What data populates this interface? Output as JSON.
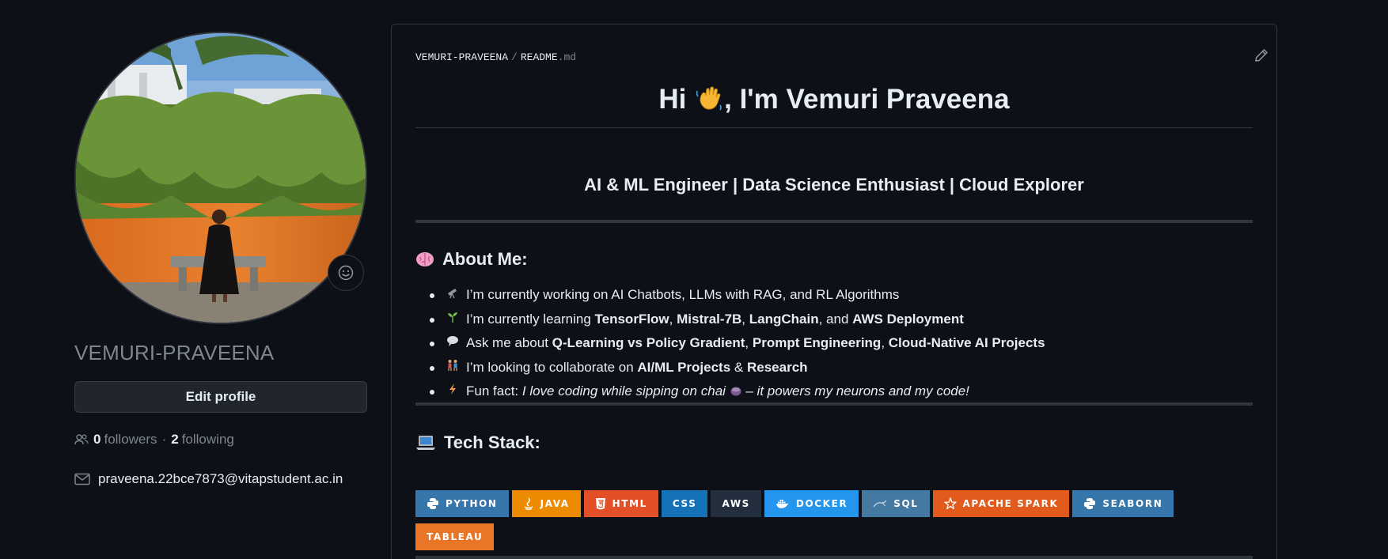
{
  "profile": {
    "username": "VEMURI-PRAVEENA",
    "edit_profile_label": "Edit profile",
    "followers_count": "0",
    "followers_label": "followers",
    "separator": "·",
    "following_count": "2",
    "following_label": "following",
    "email": "praveena.22bce7873@vitapstudent.ac.in"
  },
  "readme": {
    "crumb_owner": "VEMURI-PRAVEENA",
    "crumb_slash": "/",
    "crumb_file": "README",
    "crumb_ext": ".md",
    "title_pre": "Hi ",
    "title_post": ", I'm Vemuri Praveena",
    "subtitle": "AI & ML Engineer | Data Science Enthusiast | Cloud Explorer",
    "about_heading": "About Me:",
    "about": {
      "item1": "I’m currently working on AI Chatbots, LLMs with RAG, and RL Algorithms",
      "item2_pre": "I’m currently learning ",
      "item2_b1": "TensorFlow",
      "item2_s1": ", ",
      "item2_b2": "Mistral-7B",
      "item2_s2": ", ",
      "item2_b3": "LangChain",
      "item2_s3": ", and ",
      "item2_b4": "AWS Deployment",
      "item3_pre": "Ask me about ",
      "item3_b1": "Q-Learning vs Policy Gradient",
      "item3_s1": ", ",
      "item3_b2": "Prompt Engineering",
      "item3_s2": ", ",
      "item3_b3": "Cloud-Native AI Projects",
      "item4_pre": "I’m looking to collaborate on ",
      "item4_b1": "AI/ML Projects",
      "item4_s1": " & ",
      "item4_b2": "Research",
      "item5_pre": "Fun fact: ",
      "item5_i1": "I love coding while sipping on chai ",
      "item5_i2": " – it powers my neurons and my code!"
    },
    "tech_heading": "Tech Stack:",
    "badges": [
      {
        "label": "PYTHON",
        "color": "#3776ab",
        "icon": "python-icon"
      },
      {
        "label": "JAVA",
        "color": "#ed8b00",
        "icon": "java-icon"
      },
      {
        "label": "HTML",
        "color": "#e34f26",
        "icon": "html5-icon"
      },
      {
        "label": "CSS",
        "color": "#1572b6",
        "icon": ""
      },
      {
        "label": "AWS",
        "color": "#232f3e",
        "icon": ""
      },
      {
        "label": "DOCKER",
        "color": "#2496ed",
        "icon": "docker-icon"
      },
      {
        "label": "SQL",
        "color": "#4479a1",
        "icon": "mysql-icon"
      },
      {
        "label": "APACHE SPARK",
        "color": "#e25a1c",
        "icon": "spark-icon"
      },
      {
        "label": "SEABORN",
        "color": "#3776ab",
        "icon": "python-icon"
      },
      {
        "label": "TABLEAU",
        "color": "#e97627",
        "icon": ""
      }
    ]
  },
  "colors": {
    "background": "#0d1117",
    "border": "#30363d",
    "text": "#e6edf3",
    "muted": "#7d8590"
  }
}
